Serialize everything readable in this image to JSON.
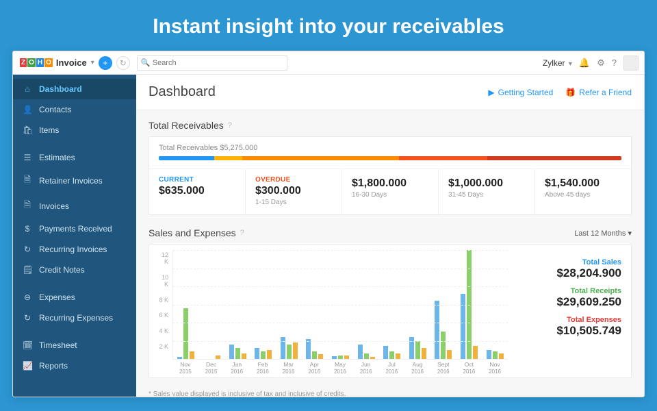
{
  "hero": {
    "title": "Instant insight into your receivables"
  },
  "brand": {
    "product": "Invoice"
  },
  "topbar": {
    "search_placeholder": "Search",
    "account": "Zylker"
  },
  "sidebar": {
    "items": [
      {
        "label": "Dashboard",
        "icon": "⌂",
        "active": true
      },
      {
        "label": "Contacts",
        "icon": "👤"
      },
      {
        "label": "Items",
        "icon": "🛍"
      },
      {
        "sep": true
      },
      {
        "label": "Estimates",
        "icon": "☰"
      },
      {
        "label": "Retainer Invoices",
        "icon": "🗎"
      },
      {
        "label": "Invoices",
        "icon": "🗎"
      },
      {
        "label": "Payments Received",
        "icon": "$"
      },
      {
        "label": "Recurring Invoices",
        "icon": "↻"
      },
      {
        "label": "Credit Notes",
        "icon": "🗒"
      },
      {
        "sep": true
      },
      {
        "label": "Expenses",
        "icon": "⊖"
      },
      {
        "label": "Recurring Expenses",
        "icon": "↻"
      },
      {
        "sep": true
      },
      {
        "label": "Timesheet",
        "icon": "🗓"
      },
      {
        "label": "Reports",
        "icon": "📈"
      }
    ]
  },
  "page": {
    "title": "Dashboard",
    "links": {
      "getting_started": "Getting Started",
      "refer": "Refer a Friend"
    }
  },
  "receivables": {
    "title": "Total Receivables",
    "total_label": "Total Receivables $5,275.000",
    "segments": [
      {
        "color": "#2196f3",
        "pct": 12
      },
      {
        "color": "#ffb300",
        "pct": 6
      },
      {
        "color": "#fb8c00",
        "pct": 34
      },
      {
        "color": "#f4511e",
        "pct": 19
      },
      {
        "color": "#d13a1f",
        "pct": 29
      }
    ],
    "cells": [
      {
        "label": "CURRENT",
        "cls": "current",
        "amount": "$635.000",
        "sub": ""
      },
      {
        "label": "OVERDUE",
        "cls": "overdue",
        "amount": "$300.000",
        "sub": "1-15 Days"
      },
      {
        "label": "",
        "cls": "",
        "amount": "$1,800.000",
        "sub": "16-30 Days"
      },
      {
        "label": "",
        "cls": "",
        "amount": "$1,000.000",
        "sub": "31-45 Days"
      },
      {
        "label": "",
        "cls": "",
        "amount": "$1,540.000",
        "sub": "Above 45 days"
      }
    ]
  },
  "sales_expenses": {
    "title": "Sales and Expenses",
    "range": "Last 12 Months",
    "totals": {
      "sales_label": "Total Sales",
      "sales": "$28,204.900",
      "receipts_label": "Total Receipts",
      "receipts": "$29,609.250",
      "expenses_label": "Total Expenses",
      "expenses": "$10,505.749"
    },
    "footnote": "* Sales value displayed is inclusive of tax and inclusive of credits."
  },
  "chart_data": {
    "type": "bar",
    "ylabel": "",
    "ylim": [
      0,
      12
    ],
    "yticks": [
      "12 K",
      "10 K",
      "8 K",
      "6 K",
      "4 K",
      "2 K"
    ],
    "categories": [
      "Nov 2015",
      "Dec 2015",
      "Jan 2016",
      "Feb 2016",
      "Mar 2016",
      "Apr 2016",
      "May 2016",
      "Jun 2016",
      "Jul 2016",
      "Aug 2016",
      "Sept 2016",
      "Oct 2016",
      "Nov 2016"
    ],
    "series": [
      {
        "name": "Sales",
        "color": "#6cb6e9",
        "values": [
          0.2,
          0.0,
          1.6,
          1.2,
          2.4,
          2.2,
          0.3,
          1.6,
          1.4,
          2.4,
          6.4,
          7.2,
          1.0
        ]
      },
      {
        "name": "Receipts",
        "color": "#8bcf6a",
        "values": [
          5.6,
          0.0,
          1.2,
          0.8,
          1.6,
          0.8,
          0.4,
          0.6,
          0.8,
          2.0,
          3.0,
          12.0,
          0.8
        ]
      },
      {
        "name": "Expenses",
        "color": "#f0b23c",
        "values": [
          0.8,
          0.4,
          0.6,
          1.0,
          1.8,
          0.5,
          0.4,
          0.2,
          0.6,
          1.2,
          1.0,
          1.4,
          0.6
        ]
      }
    ]
  }
}
